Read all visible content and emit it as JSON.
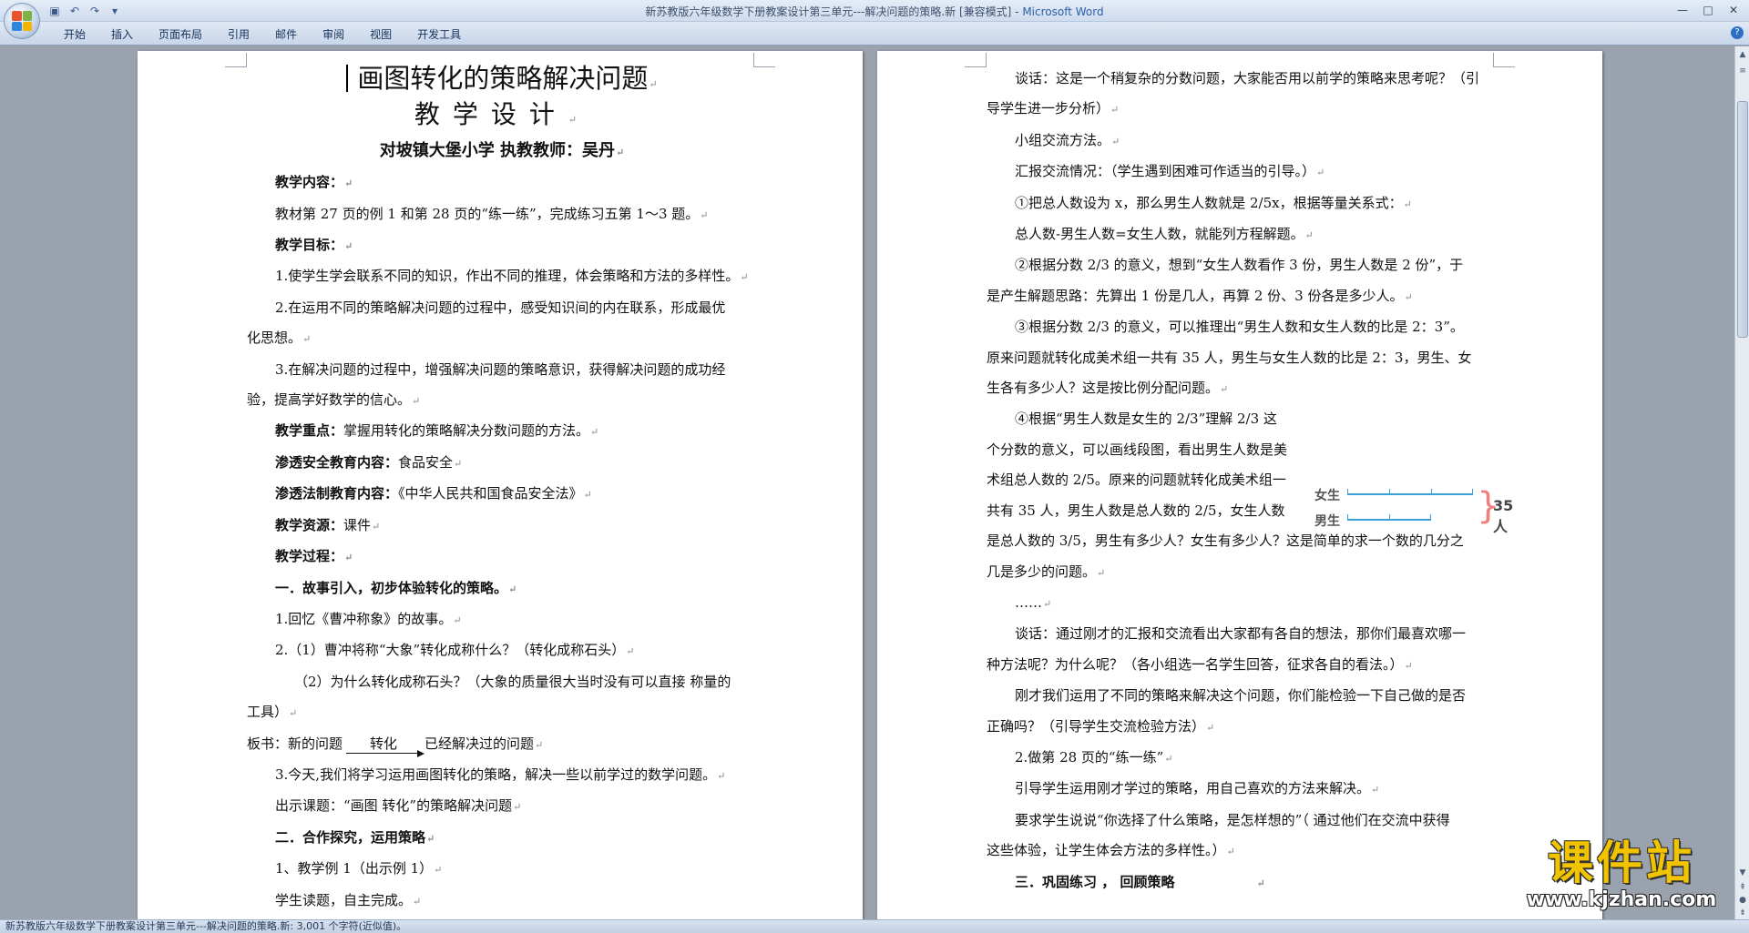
{
  "window": {
    "title": "新苏教版六年级数学下册教案设计第三单元---解决问题的策略.新 [兼容模式] - ",
    "app_name": "Microsoft Word",
    "controls": [
      "—",
      "□",
      "✕"
    ],
    "help": "?"
  },
  "ribbon": {
    "tabs": [
      "开始",
      "插入",
      "页面布局",
      "引用",
      "邮件",
      "审阅",
      "视图",
      "开发工具"
    ]
  },
  "left_page": {
    "title_line1": "画图转化的策略解决问题",
    "title_line2": "教学设计",
    "title_line3": "对坡镇大堡小学      执教教师：吴丹",
    "lines": [
      "教学内容：",
      "教材第 27 页的例 1 和第 28 页的“练一练”，完成练习五第 1～3 题。",
      "教学目标：",
      "1.使学生学会联系不同的知识，作出不同的推理，体会策略和方法的多样性。",
      "2.在运用不同的策略解决问题的过程中，感受知识间的内在联系，形成最优",
      "化思想。",
      "3.在解决问题的过程中，增强解决问题的策略意识，获得解决问题的成功经",
      "验，提高学好数学的信心。"
    ],
    "key_point_label": "教学重点：",
    "key_point": "掌握用转化的策略解决分数问题的方法。",
    "safety_label": "渗透安全教育内容：",
    "safety": "食品安全",
    "law_label": "渗透法制教育内容：",
    "law": "《中华人民共和国食品安全法》",
    "resource_label": "教学资源：",
    "resource": "课件",
    "process_label": "教学过程：",
    "section1": "一．故事引入，初步体验转化的策略。",
    "p1": "1.回忆《曹冲称象》的故事。",
    "p2": "2.（1）曹冲将称“大象”转化成称什么？（转化成称石头）",
    "p3a": "（2）为什么转化成称石头？（大象的质量很大当时没有可以直接  称量的",
    "p3b": "工具）",
    "board_prefix": "板书：新的问题",
    "board_arrow": "转化",
    "board_suffix": "已经解决过的问题",
    "p4": "3.今天,我们将学习运用画图转化的策略，解决一些以前学过的数学问题。",
    "p5": "出示课题：“画图  转化”的策略解决问题",
    "section2": "二．合作探究，运用策略",
    "p6": "1、教学例 1（出示例 1）",
    "p7": "学生读题，自主完成。"
  },
  "right_page": {
    "lines": [
      "谈话：这是一个稍复杂的分数问题，大家能否用以前学的策略来思考呢？（引",
      "导学生进一步分析）",
      "小组交流方法。",
      "汇报交流情况：（学生遇到困难可作适当的引导。）",
      "①把总人数设为 x，那么男生人数就是 2/5x，根据等量关系式：",
      "总人数-男生人数=女生人数，就能列方程解题。",
      "②根据分数 2/3 的意义，想到“女生人数看作 3 份，男生人数是 2 份”，于",
      "是产生解题思路：先算出 1 份是几人，再算 2 份、3 份各是多少人。",
      "③根据分数 2/3 的意义，可以推理出“男生人数和女生人数的比是 2：3”。",
      "原来问题就转化成美术组一共有 35 人，男生与女生人数的比是 2：3，男生、女",
      "生各有多少人？这是按比例分配问题。",
      "④根据“男生人数是女生的 2/3”理解 2/3 这",
      "个分数的意义，可以画线段图，看出男生人数是美",
      "术组总人数的 2/5。原来的问题就转化成美术组一",
      "共有 35 人，男生人数是总人数的 2/5，女生人数",
      "是总人数的 3/5，男生有多少人？女生有多少人？这是简单的求一个数的几分之",
      "几是多少的问题。",
      "……",
      "谈话：通过刚才的汇报和交流看出大家都有各自的想法，那你们最喜欢哪一",
      "种方法呢？为什么呢？（各小组选一名学生回答，征求各自的看法。）",
      "刚才我们运用了不同的策略来解决这个问题，你们能检验一下自己做的是否",
      "正确吗？（引导学生交流检验方法）",
      "2.做第 28 页的“练一练”",
      "引导学生运用刚才学过的策略，用自己喜欢的方法来解决。",
      "要求学生说说“你选择了什么策略，是怎样想的”（ 通过他们在交流中获得",
      "这些体验，让学生体会方法的多样性。）"
    ],
    "section3": "三．巩固练习  ，  回顾策略",
    "diagram": {
      "girls_label": "女生",
      "boys_label": "男生",
      "total_label": "35 人"
    }
  },
  "status_bar": {
    "text": "新苏教版六年级数学下册教案设计第三单元---解决问题的策略.新: 3,001 个字符(近似值)。"
  },
  "watermark": {
    "name": "课件站",
    "url": "www.kjzhan.com"
  },
  "colors": {
    "accent": "#2b5fa8",
    "diagram_line": "#3aa0d8",
    "brace": "#f08080",
    "watermark": "#f2c400"
  }
}
